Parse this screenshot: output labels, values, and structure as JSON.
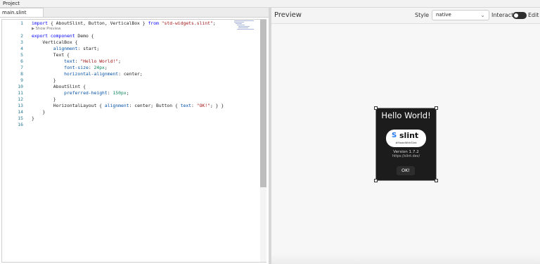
{
  "menubar": {
    "project_label": "Project"
  },
  "editor": {
    "tab_label": "main.slint",
    "codelens_label": "▶ Show Preview",
    "lines": [
      {
        "num": "1",
        "parts": [
          {
            "t": "import",
            "c": "kw"
          },
          {
            "t": " { AboutSlint, Button, VerticalBox } ",
            "c": ""
          },
          {
            "t": "from",
            "c": "kw"
          },
          {
            "t": " ",
            "c": ""
          },
          {
            "t": "\"std-widgets.slint\"",
            "c": "str"
          },
          {
            "t": ";",
            "c": ""
          }
        ]
      },
      {
        "num": "2",
        "parts": [
          {
            "t": "export component",
            "c": "kw"
          },
          {
            "t": " Demo {",
            "c": ""
          }
        ]
      },
      {
        "num": "3",
        "parts": [
          {
            "t": "    VerticalBox {",
            "c": ""
          }
        ]
      },
      {
        "num": "4",
        "parts": [
          {
            "t": "        ",
            "c": ""
          },
          {
            "t": "alignment",
            "c": "prop"
          },
          {
            "t": ": start;",
            "c": ""
          }
        ]
      },
      {
        "num": "5",
        "parts": [
          {
            "t": "        Text {",
            "c": ""
          }
        ]
      },
      {
        "num": "6",
        "parts": [
          {
            "t": "            ",
            "c": ""
          },
          {
            "t": "text",
            "c": "prop"
          },
          {
            "t": ": ",
            "c": ""
          },
          {
            "t": "\"Hello World!\"",
            "c": "str"
          },
          {
            "t": ";",
            "c": ""
          }
        ]
      },
      {
        "num": "7",
        "parts": [
          {
            "t": "            ",
            "c": ""
          },
          {
            "t": "font-size",
            "c": "prop"
          },
          {
            "t": ": ",
            "c": ""
          },
          {
            "t": "24px",
            "c": "num"
          },
          {
            "t": ";",
            "c": ""
          }
        ]
      },
      {
        "num": "8",
        "parts": [
          {
            "t": "            ",
            "c": ""
          },
          {
            "t": "horizontal-alignment",
            "c": "prop"
          },
          {
            "t": ": center;",
            "c": ""
          }
        ]
      },
      {
        "num": "9",
        "parts": [
          {
            "t": "        }",
            "c": ""
          }
        ]
      },
      {
        "num": "10",
        "parts": [
          {
            "t": "        AboutSlint {",
            "c": ""
          }
        ]
      },
      {
        "num": "11",
        "parts": [
          {
            "t": "            ",
            "c": ""
          },
          {
            "t": "preferred-height",
            "c": "prop"
          },
          {
            "t": ": ",
            "c": ""
          },
          {
            "t": "150px",
            "c": "num"
          },
          {
            "t": ";",
            "c": ""
          }
        ]
      },
      {
        "num": "12",
        "parts": [
          {
            "t": "        }",
            "c": ""
          }
        ]
      },
      {
        "num": "13",
        "parts": [
          {
            "t": "        HorizontalLayout { ",
            "c": ""
          },
          {
            "t": "alignment",
            "c": "prop"
          },
          {
            "t": ": center; Button { ",
            "c": ""
          },
          {
            "t": "text",
            "c": "prop"
          },
          {
            "t": ": ",
            "c": ""
          },
          {
            "t": "\"OK!\"",
            "c": "str"
          },
          {
            "t": "; } }",
            "c": ""
          }
        ]
      },
      {
        "num": "14",
        "parts": [
          {
            "t": "    }",
            "c": ""
          }
        ]
      },
      {
        "num": "15",
        "parts": [
          {
            "t": "}",
            "c": ""
          }
        ]
      },
      {
        "num": "16",
        "parts": []
      }
    ]
  },
  "preview": {
    "title": "Preview",
    "style_label": "Style",
    "style_value": "native",
    "interact_label": "Interact",
    "interact_on": false,
    "edit_label": "Edit",
    "demo": {
      "hello_text": "Hello World!",
      "logo_glyph": "S",
      "logo_word": "slint",
      "badge_tag": "#MadeWithSlint",
      "version_text": "Version 1.7.2",
      "url_text": "https://slint.dev/",
      "ok_label": "OK!"
    }
  },
  "colors": {
    "keyword": "#0000ff",
    "string": "#a31515",
    "property": "#0451a5",
    "number": "#098658",
    "line_number": "#237893",
    "demo_bg": "#1c1c1c",
    "slint_blue": "#2379f4"
  }
}
